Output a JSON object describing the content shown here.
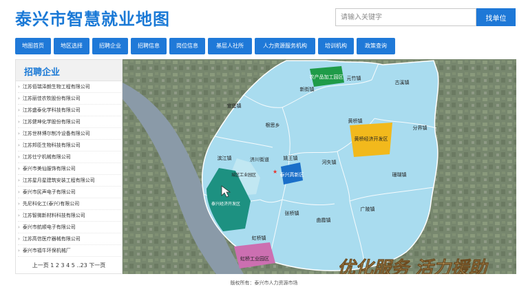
{
  "header": {
    "title": "泰兴市智慧就业地图"
  },
  "search": {
    "placeholder": "请输入关键字",
    "button": "找单位"
  },
  "nav": [
    {
      "label": "地图首页"
    },
    {
      "label": "地区选择"
    },
    {
      "label": "招聘企业"
    },
    {
      "label": "招聘信息"
    },
    {
      "label": "岗位信息"
    },
    {
      "label": "基层人社所"
    },
    {
      "label": "人力资源服务机构"
    },
    {
      "label": "培训机构"
    },
    {
      "label": "政策查询"
    }
  ],
  "sidebar": {
    "title": "招聘企业",
    "companies": [
      "江苏佰瑞泽朗生物工程有限公司",
      "江苏丽佳农牧股份有限公司",
      "江苏盛泰化学科技有限公司",
      "江苏健坤化学股份有限公司",
      "江苏世林博尔制冷设备有限公司",
      "江苏邦臣生物科技有限公司",
      "江苏仕宁机械有限公司",
      "泰兴市美仙服饰有限公司",
      "江苏星月星建筑安装工程有限公司",
      "泰兴市民声电子有限公司",
      "先尼科化工(泰兴)有限公司",
      "江苏智微新材料科技有限公司",
      "泰兴市航顺电子有限公司",
      "江苏高信医疗器械有限公司",
      "泰兴市福牛环保机械厂"
    ],
    "pager": "上一页 1 2 3 4 5 ..23 下一页"
  },
  "map": {
    "towns": [
      {
        "name": "农产品加工园区"
      },
      {
        "name": "元竹镇"
      },
      {
        "name": "古溪镇"
      },
      {
        "name": "新街镇"
      },
      {
        "name": "宣堡镇"
      },
      {
        "name": "根思乡"
      },
      {
        "name": "黄桥镇"
      },
      {
        "name": "黄桥经济开发区"
      },
      {
        "name": "分界镇"
      },
      {
        "name": "滨江镇"
      },
      {
        "name": "济川街道"
      },
      {
        "name": "姚王镇"
      },
      {
        "name": "城区工业园区"
      },
      {
        "name": "泰兴高新区"
      },
      {
        "name": "河失镇"
      },
      {
        "name": "珊瑚镇"
      },
      {
        "name": "泰兴经济开发区"
      },
      {
        "name": "张桥镇"
      },
      {
        "name": "曲霞镇"
      },
      {
        "name": "广陵镇"
      },
      {
        "name": "虹桥镇"
      },
      {
        "name": "虹桥工业园区"
      }
    ],
    "banner": "优化服务 活力援助"
  },
  "footer": {
    "text": "版权所有：泰兴市人力资源市场"
  },
  "colors": {
    "primary": "#1f79d8",
    "map_region": "#a9dcef"
  }
}
